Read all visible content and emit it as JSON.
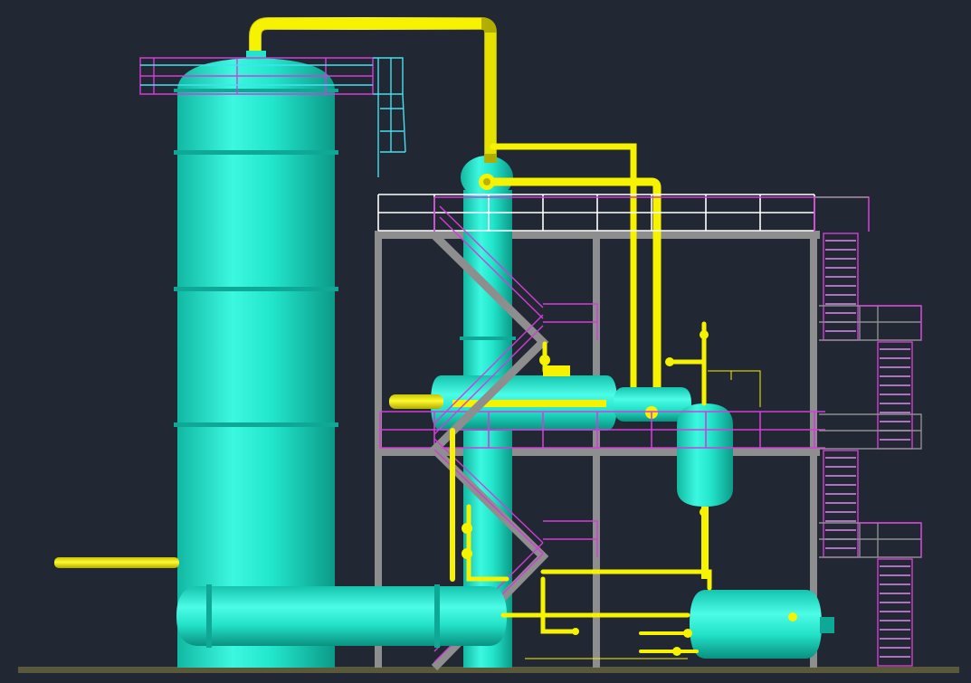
{
  "colors": {
    "background": "#222833",
    "equipment": "#19e8c8",
    "equipment_highlight": "#5cfff0",
    "equipment_shadow": "#0fa896",
    "piping": "#f6f200",
    "piping_shadow": "#b8b400",
    "structure": "#8e8e8e",
    "railing_magenta": "#d43cd8",
    "railing_cyan": "#44e0f0",
    "railing_white": "#ffffff",
    "ground": "#5a5a3a",
    "stair_tread": "#b070c0"
  },
  "components": [
    "main-column",
    "secondary-column",
    "horizontal-heat-exchanger",
    "bottom-horizontal-drum",
    "receiver-drum",
    "separator-vessel",
    "small-condenser",
    "steel-structure",
    "staircase",
    "vapor-line",
    "piping"
  ]
}
